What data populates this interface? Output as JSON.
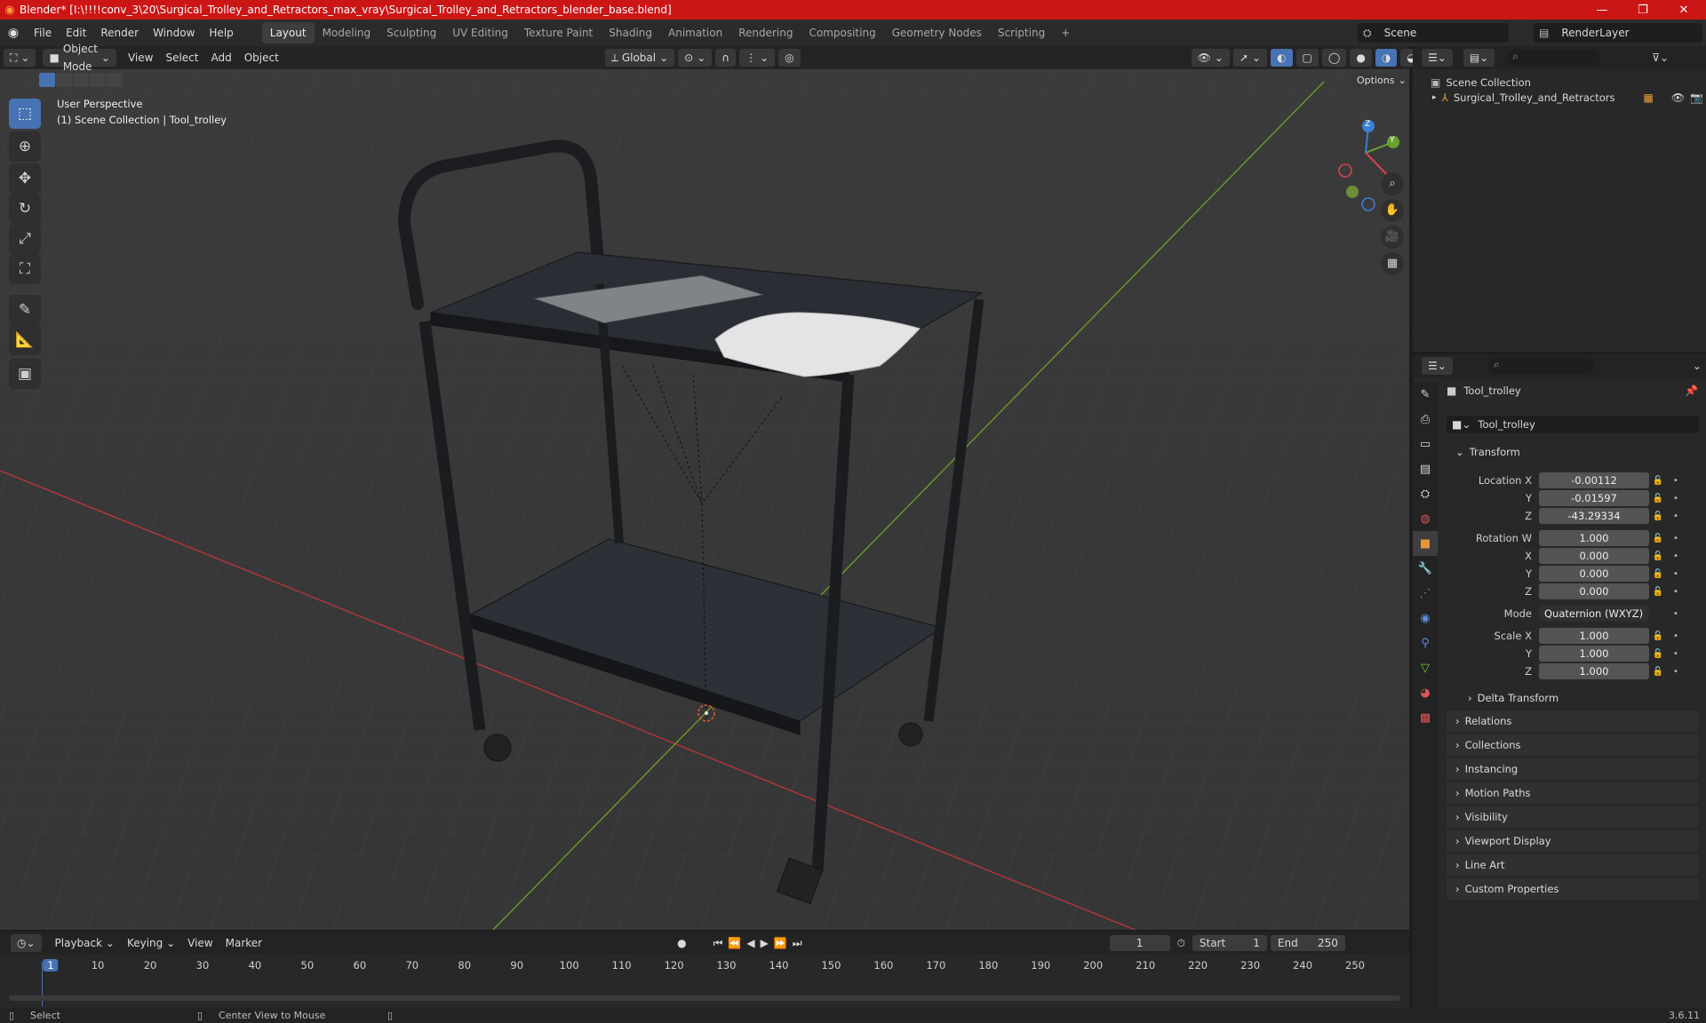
{
  "title": "Blender* [I:\\!!!!conv_3\\20\\Surgical_Trolley_and_Retractors_max_vray\\Surgical_Trolley_and_Retractors_blender_base.blend]",
  "menus": [
    "File",
    "Edit",
    "Render",
    "Window",
    "Help"
  ],
  "workspaces": [
    "Layout",
    "Modeling",
    "Sculpting",
    "UV Editing",
    "Texture Paint",
    "Shading",
    "Animation",
    "Rendering",
    "Compositing",
    "Geometry Nodes",
    "Scripting"
  ],
  "scene_label": "Scene",
  "renderlayer_label": "RenderLayer",
  "viewport": {
    "mode": "Object Mode",
    "menus": [
      "View",
      "Select",
      "Add",
      "Object"
    ],
    "transform_orientation": "Global",
    "options": "Options",
    "overlay_line1": "User Perspective",
    "overlay_line2": "(1) Scene Collection | Tool_trolley",
    "gizmo_axes": [
      "X",
      "Y",
      "Z"
    ]
  },
  "outliner": {
    "root": "Scene Collection",
    "items": [
      "Surgical_Trolley_and_Retractors"
    ]
  },
  "properties": {
    "object_name": "Tool_trolley",
    "datablock_name": "Tool_trolley",
    "transform_header": "Transform",
    "location_label": "Location X",
    "location": [
      "-0.00112",
      "-0.01597",
      "-43.29334"
    ],
    "rotation_label": "Rotation W",
    "rotation": [
      "1.000",
      "0.000",
      "0.000",
      "0.000"
    ],
    "axis_y": "Y",
    "axis_z": "Z",
    "axis_x": "X",
    "mode_label": "Mode",
    "mode_value": "Quaternion (WXYZ)",
    "scale_label": "Scale X",
    "scale": [
      "1.000",
      "1.000",
      "1.000"
    ],
    "delta": "Delta Transform",
    "panels": [
      "Relations",
      "Collections",
      "Instancing",
      "Motion Paths",
      "Visibility",
      "Viewport Display",
      "Line Art",
      "Custom Properties"
    ]
  },
  "timeline": {
    "menus": [
      "Playback",
      "Keying",
      "View",
      "Marker"
    ],
    "current_frame": "1",
    "start_label": "Start",
    "start": "1",
    "end_label": "End",
    "end": "250",
    "ticks": [
      "1",
      "10",
      "20",
      "30",
      "40",
      "50",
      "60",
      "70",
      "80",
      "90",
      "100",
      "110",
      "120",
      "130",
      "140",
      "150",
      "160",
      "170",
      "180",
      "190",
      "200",
      "210",
      "220",
      "230",
      "240",
      "250"
    ]
  },
  "status": {
    "select": "Select",
    "center": "Center View to Mouse",
    "version": "3.6.11"
  },
  "colors": {
    "title_bg": "#cc1515",
    "accent": "#4772b3",
    "x_axis": "#b5353a",
    "y_axis": "#6a9a28"
  }
}
